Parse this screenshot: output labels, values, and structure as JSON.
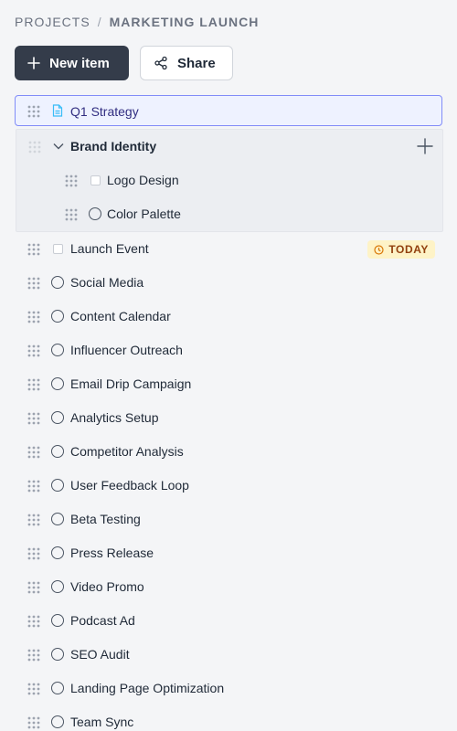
{
  "breadcrumb": {
    "root": "PROJECTS",
    "separator": "/",
    "current": "MARKETING LAUNCH"
  },
  "toolbar": {
    "new_item_label": "New item",
    "share_label": "Share"
  },
  "selected_item": {
    "label": "Q1 Strategy",
    "icon": "document-icon"
  },
  "group": {
    "label": "Brand Identity",
    "children": [
      {
        "label": "Logo Design",
        "icon": "checkbox-icon"
      },
      {
        "label": "Color Palette",
        "icon": "circle-icon"
      }
    ]
  },
  "launch_event": {
    "label": "Launch Event",
    "badge": "TODAY",
    "badge_icon": "clock-icon"
  },
  "items": [
    "Social Media",
    "Content Calendar",
    "Influencer Outreach",
    "Email Drip Campaign",
    "Analytics Setup",
    "Competitor Analysis",
    "User Feedback Loop",
    "Beta Testing",
    "Press Release",
    "Video Promo",
    "Podcast Ad",
    "SEO Audit",
    "Landing Page Optimization",
    "Team Sync"
  ],
  "colors": {
    "primary_button": "#343c4a",
    "selected_border": "#818cf8",
    "selected_bg": "#eef2ff",
    "badge_bg": "#fef3c7",
    "badge_text": "#92400e",
    "doc_icon": "#38bdf8"
  }
}
